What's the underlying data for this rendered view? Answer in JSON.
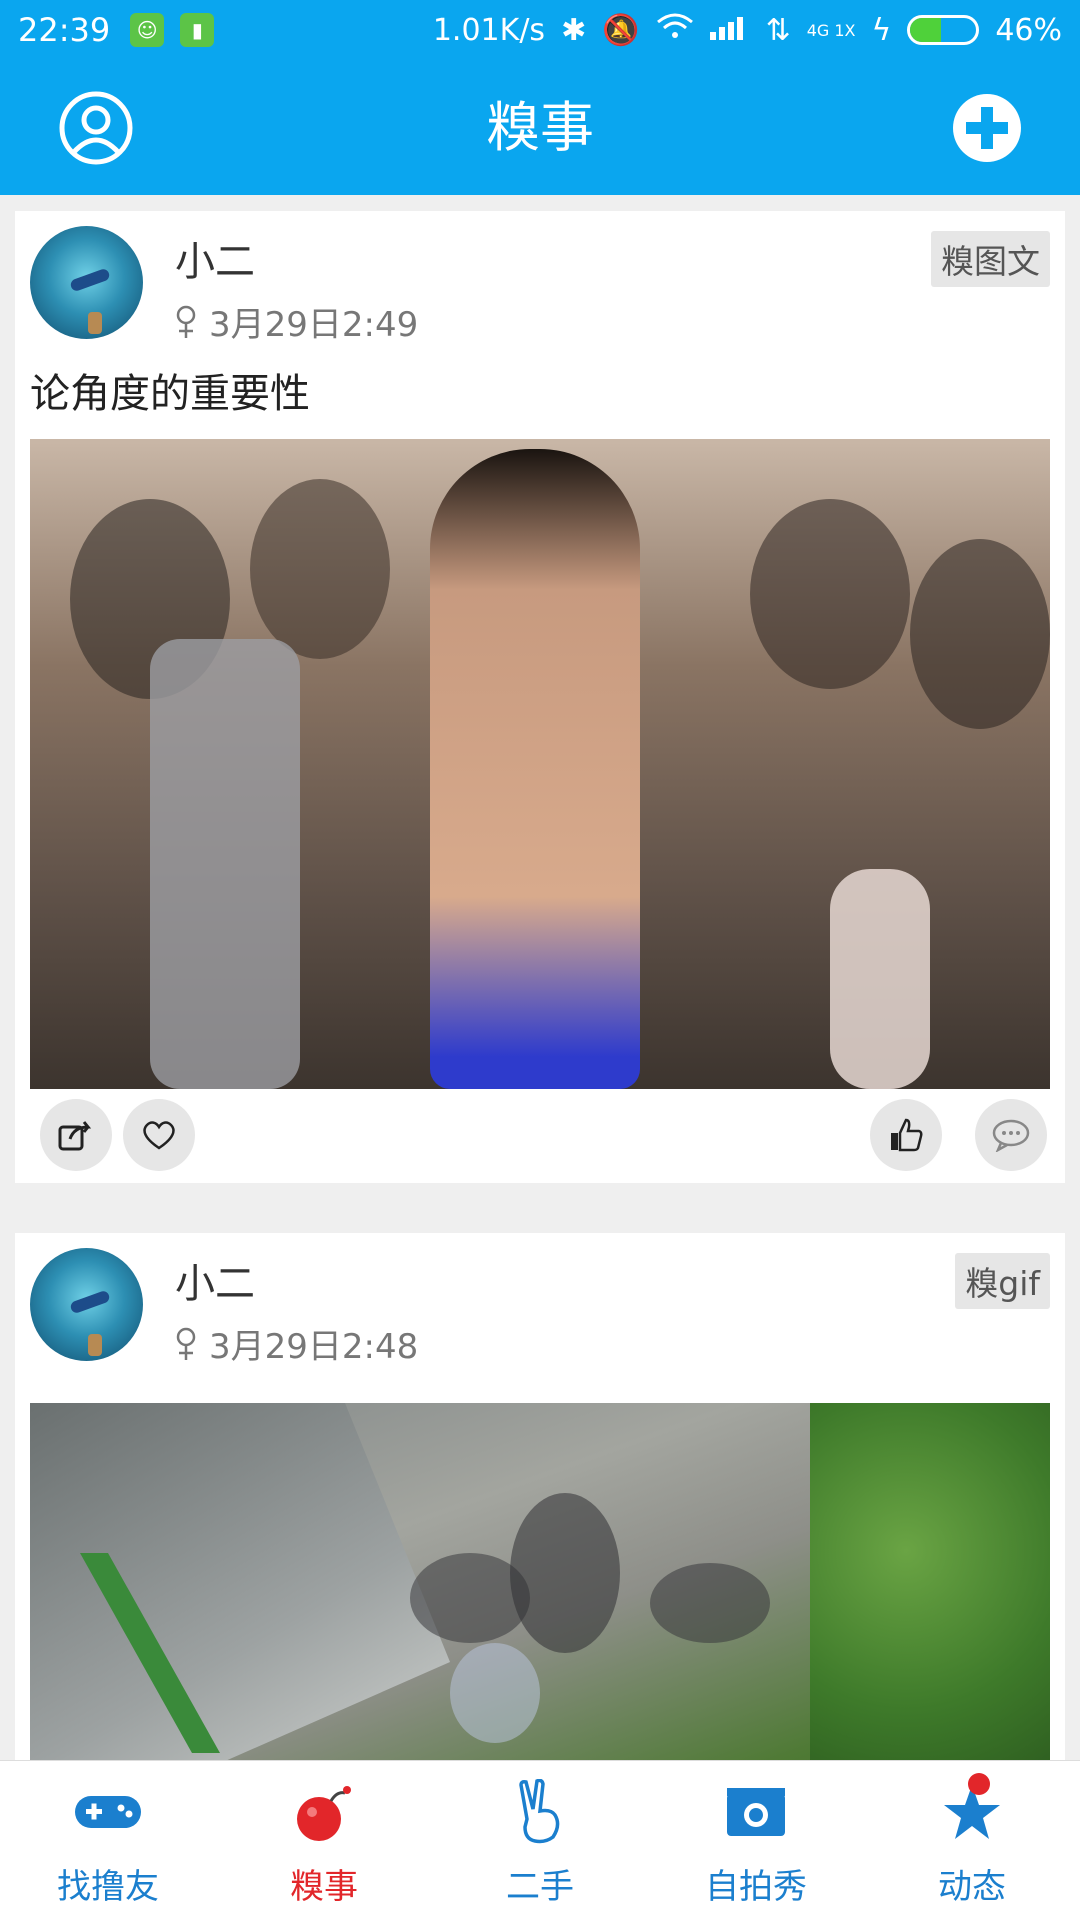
{
  "status_bar": {
    "time": "22:39",
    "speed": "1.01K/s",
    "battery": "46%",
    "battery_fraction": 0.46,
    "network": "4G 1X"
  },
  "app_bar": {
    "title": "糗事",
    "left_icon": "user-icon",
    "right_icon": "add-icon"
  },
  "posts": [
    {
      "username": "小二",
      "gender_icon": "female-icon",
      "time": "3月29日2:49",
      "tag": "糗图文",
      "title": "论角度的重要性"
    },
    {
      "username": "小二",
      "gender_icon": "female-icon",
      "time": "3月29日2:48",
      "tag": "糗gif"
    }
  ],
  "bottom_nav": [
    {
      "label": "找撸友",
      "icon": "gamepad-icon"
    },
    {
      "label": "糗事",
      "icon": "bomb-icon",
      "active": true
    },
    {
      "label": "二手",
      "icon": "peace-hand-icon"
    },
    {
      "label": "自拍秀",
      "icon": "camera-icon"
    },
    {
      "label": "动态",
      "icon": "star-icon"
    }
  ],
  "colors": {
    "primary": "#0aa6ef",
    "accent_red": "#e2262a",
    "nav_blue": "#1b7fce"
  }
}
